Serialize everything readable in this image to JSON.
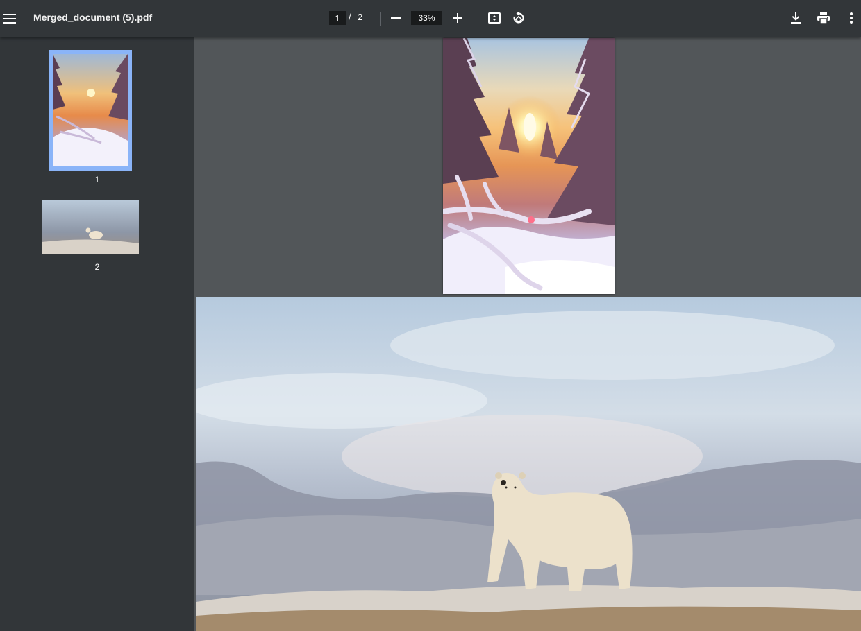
{
  "toolbar": {
    "title": "Merged_document (5).pdf",
    "current_page": "1",
    "page_separator": "/",
    "total_pages": "2",
    "zoom": "33%",
    "icons": {
      "menu": "menu-icon",
      "zoom_out": "minus-icon",
      "zoom_in": "plus-icon",
      "fit": "fit-to-page-icon",
      "rotate": "rotate-icon",
      "download": "download-icon",
      "print": "print-icon",
      "more": "more-vertical-icon"
    }
  },
  "sidebar": {
    "thumbnails": [
      {
        "label": "1",
        "selected": true
      },
      {
        "label": "2",
        "selected": false
      }
    ],
    "selection_color": "#8ab4f8"
  },
  "colors": {
    "toolbar_bg": "#323639",
    "viewer_bg": "#525659",
    "input_bg": "#191b1c"
  }
}
